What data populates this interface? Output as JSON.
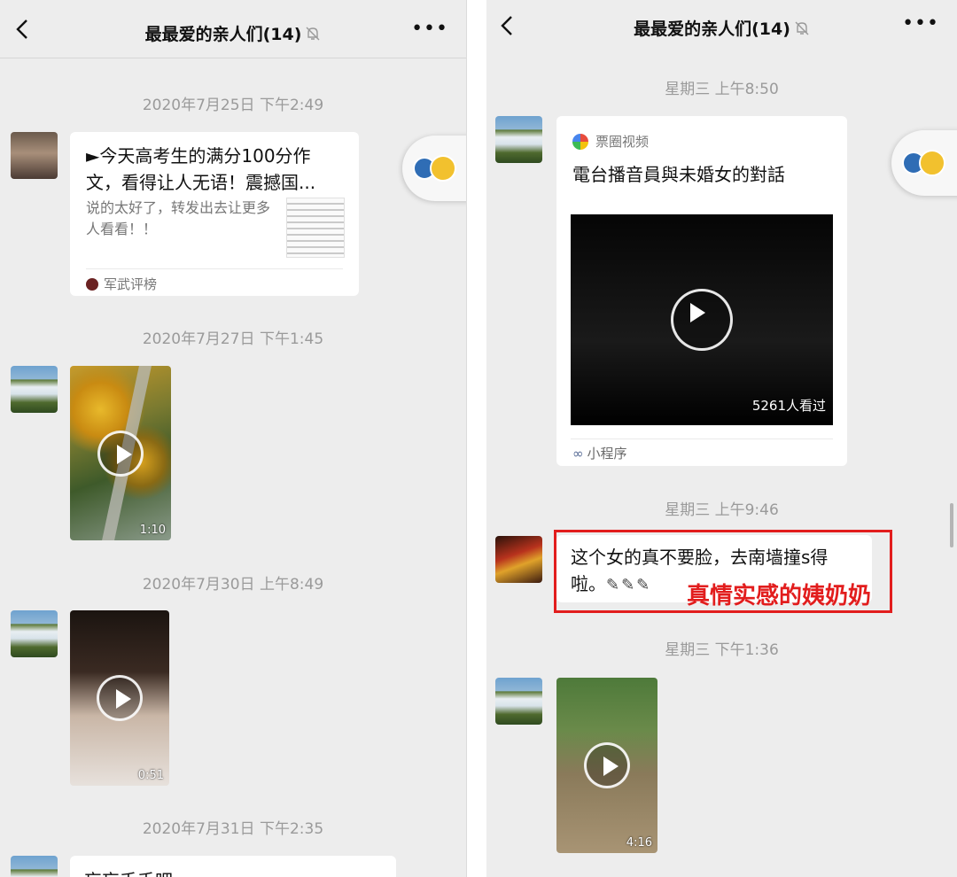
{
  "left": {
    "title": "最最爱的亲人们(14)",
    "timestamps": [
      "2020年7月25日 下午2:49",
      "2020年7月27日 下午1:45",
      "2020年7月30日 上午8:49",
      "2020年7月31日 下午2:35"
    ],
    "link_card": {
      "title": "►今天高考生的满分100分作文，看得让人无语！震撼国...",
      "desc": "说的太好了，转发出去让更多人看看！！",
      "source": "军武评榜"
    },
    "video1": {
      "duration": "1:10"
    },
    "video2": {
      "duration": "0:51"
    },
    "partial_text": "忘忘千千吧"
  },
  "right": {
    "title": "最最爱的亲人们(14)",
    "timestamps": [
      "星期三 上午8:50",
      "星期三 上午9:46",
      "星期三 下午1:36"
    ],
    "mini_program": {
      "app_name": "票圈视频",
      "title": "電台播音員與未婚女的對話",
      "views": "5261人看过",
      "footer": "小程序"
    },
    "text_message": {
      "line1": "这个女的真不要脸，去南墙撞s得",
      "line2": "啦。"
    },
    "annotation": "真情实感的姨奶奶",
    "video": {
      "duration": "4:16"
    }
  },
  "icons": [
    "back-arrow-icon",
    "mute-bell-icon",
    "more-dots-icon",
    "play-icon"
  ]
}
